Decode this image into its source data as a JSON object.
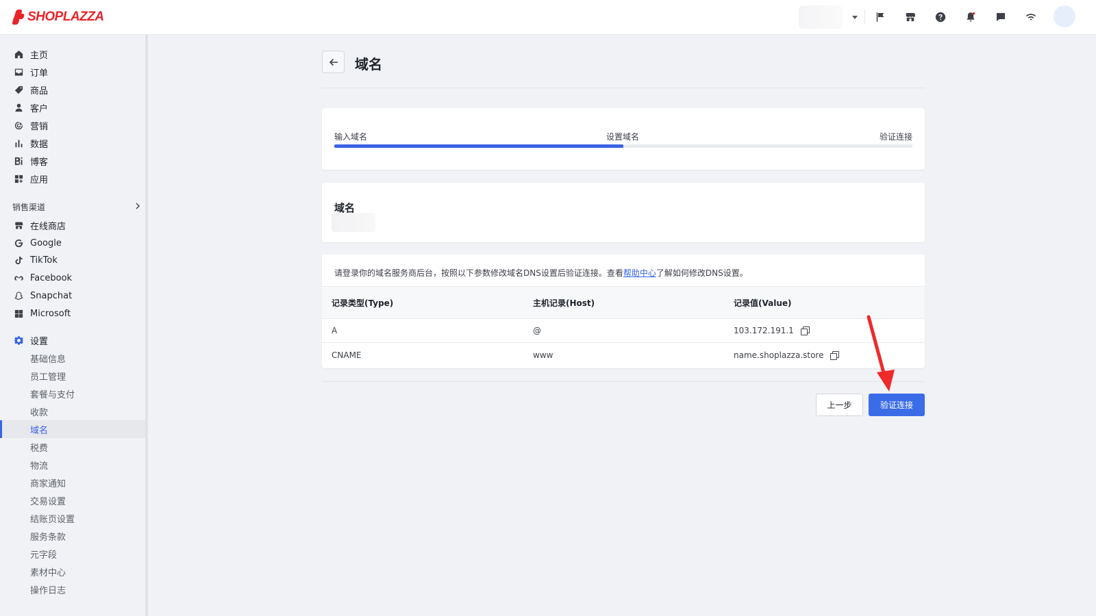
{
  "header": {
    "brand": "SHOPLAZZA",
    "brand_color": "#e8242a",
    "store_selector_value": "",
    "icons": [
      "flag-icon",
      "store-icon",
      "help-icon",
      "bell-icon",
      "chat-icon",
      "wifi-icon"
    ]
  },
  "sidebar": {
    "main_items": [
      {
        "label": "主页",
        "icon": "home-icon"
      },
      {
        "label": "订单",
        "icon": "inbox-icon"
      },
      {
        "label": "商品",
        "icon": "tag-icon"
      },
      {
        "label": "客户",
        "icon": "person-icon"
      },
      {
        "label": "营销",
        "icon": "marketing-icon"
      },
      {
        "label": "数据",
        "icon": "bar-chart-icon"
      },
      {
        "label": "博客",
        "icon": "blog-icon"
      },
      {
        "label": "应用",
        "icon": "apps-icon"
      }
    ],
    "channels_label": "销售渠道",
    "channels": [
      {
        "label": "在线商店",
        "icon": "store-icon"
      },
      {
        "label": "Google",
        "icon": "google-icon"
      },
      {
        "label": "TikTok",
        "icon": "tiktok-icon"
      },
      {
        "label": "Facebook",
        "icon": "meta-icon"
      },
      {
        "label": "Snapchat",
        "icon": "snapchat-icon"
      },
      {
        "label": "Microsoft",
        "icon": "microsoft-icon"
      }
    ],
    "settings_label": "设置",
    "settings_items": [
      "基础信息",
      "员工管理",
      "套餐与支付",
      "收款",
      "域名",
      "税费",
      "物流",
      "商家通知",
      "交易设置",
      "结账页设置",
      "服务条款",
      "元字段",
      "素材中心",
      "操作日志"
    ],
    "active_item": "域名",
    "accent_color": "#3863e5"
  },
  "main": {
    "title": "域名",
    "steps": [
      "输入域名",
      "设置域名",
      "验证连接"
    ],
    "progress_fraction": 0.5,
    "domain_card_title": "域名",
    "dns_intro_before": "请登录你的域名服务商后台，按照以下参数修改域名DNS设置后验证连接。查看",
    "dns_intro_link": "帮助中心",
    "dns_intro_after": "了解如何修改DNS设置。",
    "table": {
      "headers": [
        "记录类型(Type)",
        "主机记录(Host)",
        "记录值(Value)"
      ],
      "rows": [
        [
          "A",
          "@",
          "103.172.191.1"
        ],
        [
          "CNAME",
          "www",
          "name.shoplazza.store"
        ]
      ]
    },
    "prev_button": "上一步",
    "verify_button": "验证连接"
  }
}
